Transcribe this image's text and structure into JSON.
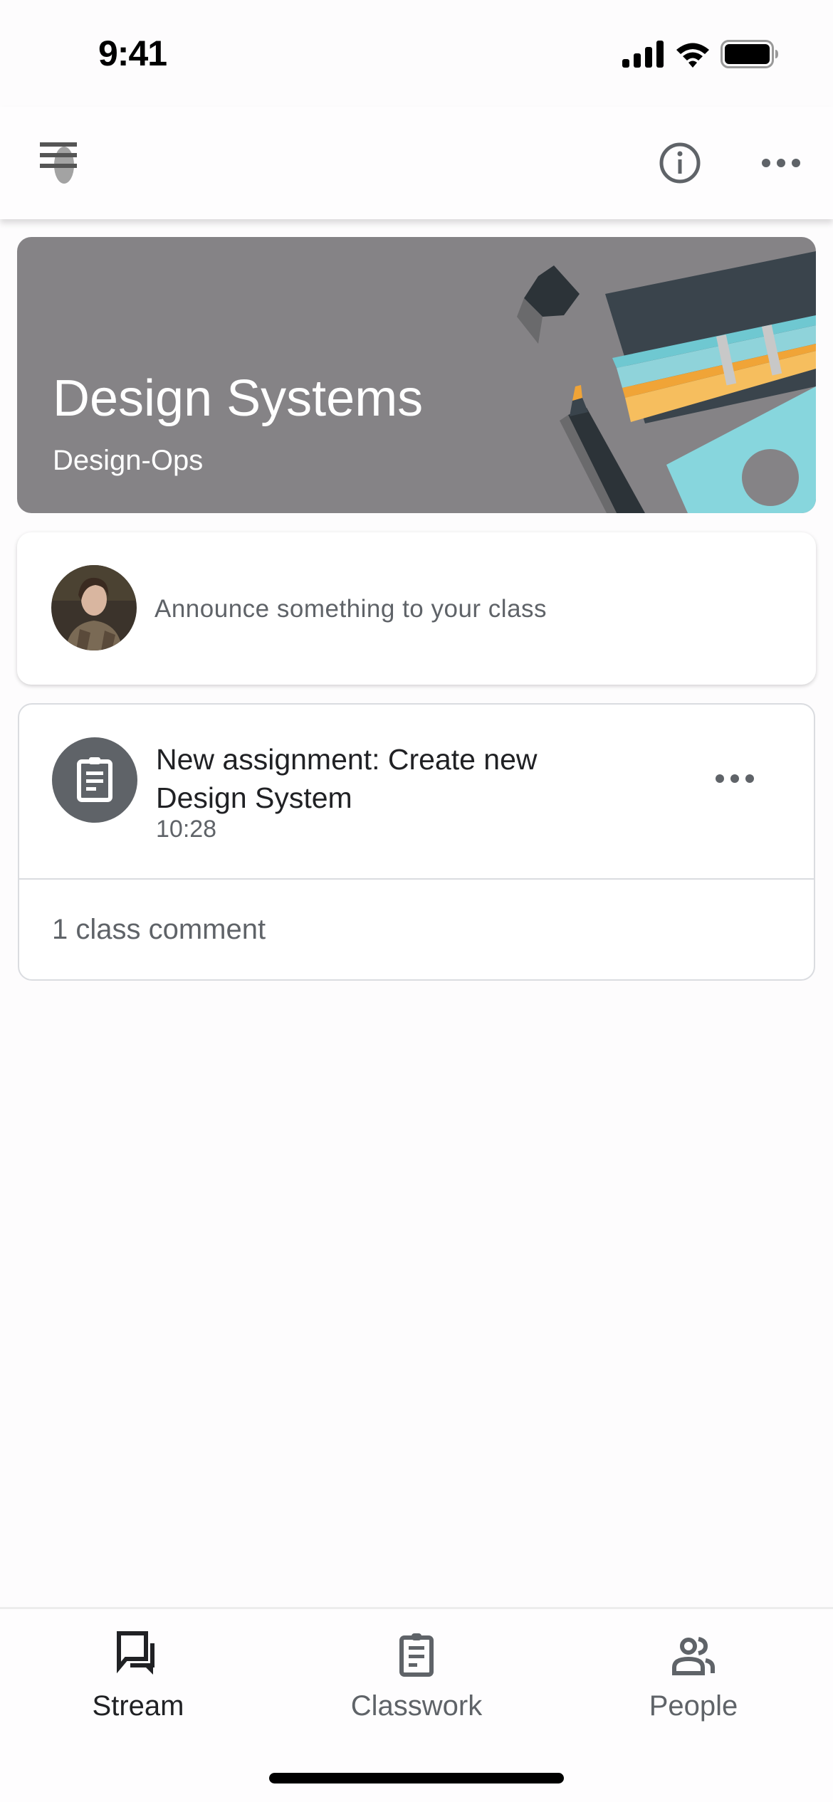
{
  "status_bar": {
    "time": "9:41",
    "icons": [
      "cellular-signal-icon",
      "wifi-icon",
      "battery-icon"
    ]
  },
  "header": {
    "menu_icon": "hamburger-menu-icon",
    "info_icon": "info-icon",
    "more_icon": "more-horizontal-icon"
  },
  "banner": {
    "title": "Design Systems",
    "subtitle": "Design-Ops",
    "background_color": "#858386"
  },
  "announce": {
    "placeholder": "Announce something to your class",
    "avatar": "user-avatar"
  },
  "stream": {
    "items": [
      {
        "icon": "assignment-icon",
        "title": "New assignment: Create new Design System",
        "time": "10:28",
        "comments": "1 class comment"
      }
    ]
  },
  "bottom_nav": {
    "items": [
      {
        "label": "Stream",
        "icon": "stream-icon",
        "active": true
      },
      {
        "label": "Classwork",
        "icon": "classwork-icon",
        "active": false
      },
      {
        "label": "People",
        "icon": "people-icon",
        "active": false
      }
    ]
  }
}
